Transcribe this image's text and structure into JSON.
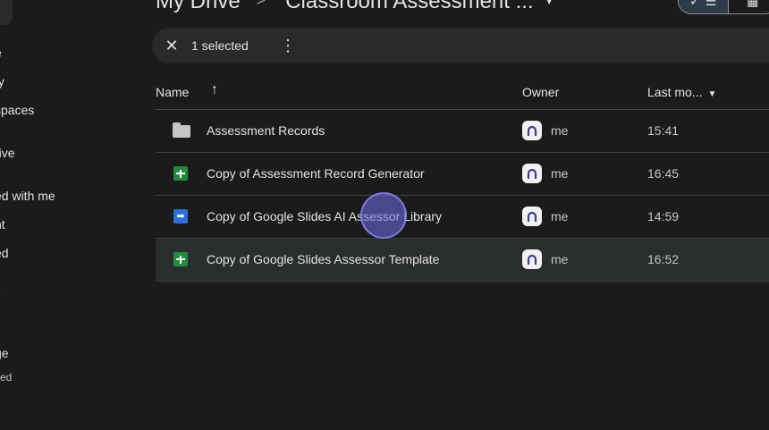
{
  "sidebar": {
    "items": [
      {
        "label": "e"
      },
      {
        "label": "ty"
      },
      {
        "label": "spaces"
      },
      {
        "label": "rive"
      },
      {
        "label": "ed with me"
      },
      {
        "label": "nt"
      },
      {
        "label": "ed"
      },
      {
        "label": "ge"
      }
    ],
    "storage_text": "sed"
  },
  "breadcrumb": {
    "root": "My Drive",
    "separator": ">",
    "current": "Classroom Assessment ...",
    "caret": "▾"
  },
  "view_toggle": {
    "list_icon": "list-view-icon",
    "grid_icon": "grid-view-icon",
    "check": "✓"
  },
  "selection_bar": {
    "close_icon": "close-icon",
    "count_label": "1 selected",
    "more_icon": "more-vert-icon"
  },
  "table": {
    "headers": {
      "name": "Name",
      "owner": "Owner",
      "modified": "Last mo..."
    },
    "rows": [
      {
        "icon": "folder-icon",
        "name": "Assessment Records",
        "owner": "me",
        "modified": "15:41",
        "selected": false
      },
      {
        "icon": "sheets-icon",
        "name": "Copy of Assessment Record Generator",
        "owner": "me",
        "modified": "16:45",
        "selected": false
      },
      {
        "icon": "apps-script-icon",
        "name": "Copy of Google Slides AI Assessor Library",
        "owner": "me",
        "modified": "14:59",
        "selected": false
      },
      {
        "icon": "sheets-icon",
        "name": "Copy of Google Slides Assessor Template",
        "owner": "me",
        "modified": "16:52",
        "selected": true
      }
    ]
  },
  "colors": {
    "background": "#1b1b1b",
    "selection_bar": "#282a2c",
    "selected_row": "#2a2d2e",
    "sheets_green": "#1e8e3e",
    "script_blue": "#2a6fdb",
    "cursor_highlight": "#6e6ee6"
  }
}
